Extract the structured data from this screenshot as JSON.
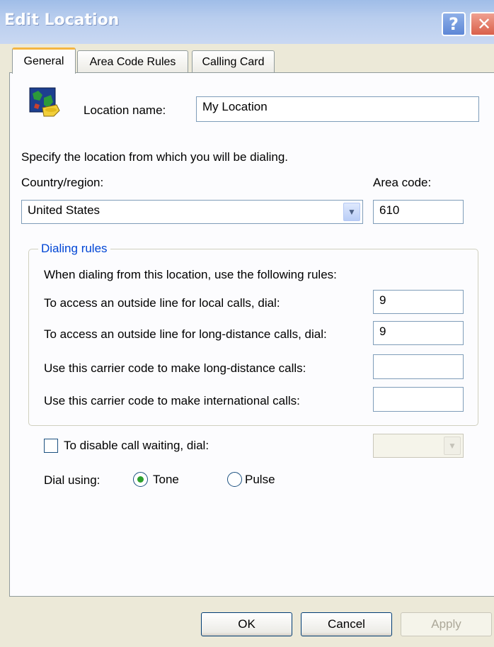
{
  "window": {
    "title": "Edit Location",
    "help_glyph": "?",
    "close_glyph": "✕"
  },
  "tabs": [
    {
      "label": "General",
      "active": true
    },
    {
      "label": "Area Code Rules",
      "active": false
    },
    {
      "label": "Calling Card",
      "active": false
    }
  ],
  "general": {
    "location_name_label": "Location name:",
    "location_name_value": "My Location",
    "instructions": "Specify the location from which you will be dialing.",
    "country_label": "Country/region:",
    "country_value": "United States",
    "area_code_label": "Area code:",
    "area_code_value": "610"
  },
  "dialing_rules": {
    "legend": "Dialing rules",
    "intro": "When dialing from this location, use the following rules:",
    "rows": [
      {
        "label": "To access an outside line for local calls, dial:",
        "value": "9"
      },
      {
        "label": "To access an outside line for long-distance calls, dial:",
        "value": "9"
      },
      {
        "label": "Use this carrier code to make long-distance calls:",
        "value": ""
      },
      {
        "label": "Use this carrier code to make international calls:",
        "value": ""
      }
    ]
  },
  "call_waiting": {
    "label": "To disable call waiting, dial:",
    "checked": false,
    "value": ""
  },
  "dial_using": {
    "label": "Dial using:",
    "options": [
      {
        "label": "Tone",
        "selected": true
      },
      {
        "label": "Pulse",
        "selected": false
      }
    ]
  },
  "buttons": {
    "ok": "OK",
    "cancel": "Cancel",
    "apply": "Apply"
  },
  "colors": {
    "accent": "#0046d5",
    "tab_highlight": "#f5b642",
    "radio_selected": "#2da02d"
  },
  "icons": {
    "location_icon": "globe-phone-icon",
    "dropdown_icon": "chevron-down-icon"
  }
}
